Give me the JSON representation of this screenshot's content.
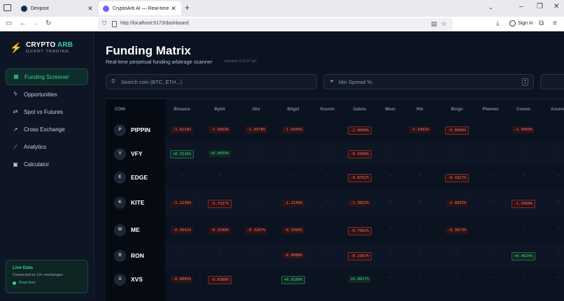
{
  "browser": {
    "tabs": [
      {
        "title": "Devpost",
        "active": false
      },
      {
        "title": "CryptoArb AI — Real-time Cryp",
        "active": true
      }
    ],
    "url": "http://localhost:5173/dashboard",
    "sign_in": "Sign in"
  },
  "sidebar": {
    "logo_title_a": "CRYPTO",
    "logo_title_b": " ARB",
    "logo_sub": "QUANT TRADING",
    "items": [
      {
        "label": "Funding Screener",
        "icon": "grid-icon",
        "active": true
      },
      {
        "label": "Opportunities",
        "icon": "zap-icon",
        "active": false
      },
      {
        "label": "Spot vs Futures",
        "icon": "arrows-icon",
        "active": false
      },
      {
        "label": "Cross Exchange",
        "icon": "trend-icon",
        "active": false
      },
      {
        "label": "Analytics",
        "icon": "chart-icon",
        "active": false
      },
      {
        "label": "Calculator",
        "icon": "calculator-icon",
        "active": false
      }
    ],
    "live": {
      "title": "Live Data",
      "subtitle": "Connected to 13+ exchanges",
      "status": "Real-time"
    }
  },
  "main": {
    "title": "Funding Matrix",
    "subtitle": "Real-time perpetual funding arbitrage scanner",
    "updated": "Updated: 8:21:47 pm",
    "search_placeholder": "Search coin (BTC, ETH...)",
    "spread_placeholder": "Min Spread %:"
  },
  "matrix": {
    "coin_header": "COIN",
    "exchanges": [
      "Binance",
      "Bybit",
      "Okx",
      "Bitget",
      "Kucoin",
      "Gateio",
      "Mexc",
      "Htx",
      "Bingx",
      "Phemex",
      "Coinex",
      "Ascend"
    ],
    "rows": [
      {
        "initial": "P",
        "symbol": "PIPPIN",
        "cells": [
          {
            "v": "-1.6218%",
            "t": "neg",
            "box": false
          },
          {
            "v": "-1.5859%",
            "t": "neg",
            "box": false
          },
          {
            "v": "-1.4978%",
            "t": "neg",
            "box": false
          },
          {
            "v": "-1.5945%",
            "t": "neg",
            "box": false
          },
          {
            "v": "–",
            "t": "none"
          },
          {
            "v": "-2.0000%",
            "t": "neg",
            "box": true
          },
          {
            "v": "–",
            "t": "none"
          },
          {
            "v": "-1.5491%",
            "t": "neg",
            "box": false
          },
          {
            "v": "-0.8000%",
            "t": "neg",
            "box": true
          },
          {
            "v": "–",
            "t": "none"
          },
          {
            "v": "-1.5000%",
            "t": "neg",
            "box": false
          },
          {
            "v": "–",
            "t": "none"
          }
        ]
      },
      {
        "initial": "V",
        "symbol": "VFY",
        "cells": [
          {
            "v": "+0.3126%",
            "t": "pos",
            "box": true
          },
          {
            "v": "+0.0050%",
            "t": "pos",
            "box": false
          },
          {
            "v": "–",
            "t": "none"
          },
          {
            "v": "–",
            "t": "none"
          },
          {
            "v": "–",
            "t": "none"
          },
          {
            "v": "-0.4909%",
            "t": "neg",
            "box": true
          },
          {
            "v": "–",
            "t": "none"
          },
          {
            "v": "–",
            "t": "none"
          },
          {
            "v": "–",
            "t": "none"
          },
          {
            "v": "–",
            "t": "none"
          },
          {
            "v": "–",
            "t": "none"
          },
          {
            "v": "–",
            "t": "none"
          }
        ]
      },
      {
        "initial": "E",
        "symbol": "EDGE",
        "cells": [
          {
            "v": "–",
            "t": "none"
          },
          {
            "v": "–",
            "t": "none"
          },
          {
            "v": "–",
            "t": "none"
          },
          {
            "v": "–",
            "t": "none"
          },
          {
            "v": "–",
            "t": "none"
          },
          {
            "v": "-0.8752%",
            "t": "neg",
            "box": true
          },
          {
            "v": "–",
            "t": "none"
          },
          {
            "v": "–",
            "t": "none"
          },
          {
            "v": "-0.1027%",
            "t": "neg",
            "box": true
          },
          {
            "v": "–",
            "t": "none"
          },
          {
            "v": "–",
            "t": "none"
          },
          {
            "v": "–",
            "t": "none"
          }
        ]
      },
      {
        "initial": "K",
        "symbol": "KITE",
        "cells": [
          {
            "v": "-1.2236%",
            "t": "neg",
            "box": false
          },
          {
            "v": "-0.7327%",
            "t": "neg",
            "box": true
          },
          {
            "v": "–",
            "t": "none"
          },
          {
            "v": "-1.2149%",
            "t": "neg",
            "box": false
          },
          {
            "v": "–",
            "t": "none"
          },
          {
            "v": "-1.3825%",
            "t": "neg",
            "box": false
          },
          {
            "v": "–",
            "t": "none"
          },
          {
            "v": "–",
            "t": "none"
          },
          {
            "v": "-1.0835%",
            "t": "neg",
            "box": false
          },
          {
            "v": "–",
            "t": "none"
          },
          {
            "v": "-1.5000%",
            "t": "neg",
            "box": true
          },
          {
            "v": "–",
            "t": "none"
          }
        ]
      },
      {
        "initial": "M",
        "symbol": "ME",
        "cells": [
          {
            "v": "-0.3642%",
            "t": "neg",
            "box": false
          },
          {
            "v": "-0.2548%",
            "t": "neg",
            "box": false
          },
          {
            "v": "-0.3207%",
            "t": "neg",
            "box": false
          },
          {
            "v": "-0.3399%",
            "t": "neg",
            "box": false
          },
          {
            "v": "–",
            "t": "none"
          },
          {
            "v": "-0.7962%",
            "t": "neg",
            "box": true
          },
          {
            "v": "–",
            "t": "none"
          },
          {
            "v": "–",
            "t": "none"
          },
          {
            "v": "-0.3673%",
            "t": "neg",
            "box": false
          },
          {
            "v": "–",
            "t": "none"
          },
          {
            "v": "–",
            "t": "none"
          },
          {
            "v": "–",
            "t": "none"
          }
        ]
      },
      {
        "initial": "R",
        "symbol": "RON",
        "cells": [
          {
            "v": "–",
            "t": "none"
          },
          {
            "v": "–",
            "t": "none"
          },
          {
            "v": "–",
            "t": "none"
          },
          {
            "v": "-0.0088%",
            "t": "neg",
            "box": false
          },
          {
            "v": "–",
            "t": "none"
          },
          {
            "v": "-0.1967%",
            "t": "neg",
            "box": true
          },
          {
            "v": "–",
            "t": "none"
          },
          {
            "v": "–",
            "t": "none"
          },
          {
            "v": "–",
            "t": "none"
          },
          {
            "v": "–",
            "t": "none"
          },
          {
            "v": "+0.4624%",
            "t": "pos",
            "box": true
          },
          {
            "v": "–",
            "t": "none"
          }
        ]
      },
      {
        "initial": "X",
        "symbol": "XVS",
        "cells": [
          {
            "v": "-0.0095%",
            "t": "neg",
            "box": false
          },
          {
            "v": "-0.6308%",
            "t": "neg",
            "box": true
          },
          {
            "v": "–",
            "t": "none"
          },
          {
            "v": "+0.0100%",
            "t": "pos",
            "box": true
          },
          {
            "v": "–",
            "t": "none"
          },
          {
            "v": "+0.0027%",
            "t": "pos",
            "box": false
          },
          {
            "v": "–",
            "t": "none"
          },
          {
            "v": "–",
            "t": "none"
          },
          {
            "v": "–",
            "t": "none"
          },
          {
            "v": "–",
            "t": "none"
          },
          {
            "v": "–",
            "t": "none"
          },
          {
            "v": "–",
            "t": "none"
          }
        ]
      }
    ]
  },
  "colors": {
    "accent": "#2dd4a0",
    "negative": "#ff6b6b",
    "positive": "#3ddc97",
    "background": "#0b1220"
  }
}
